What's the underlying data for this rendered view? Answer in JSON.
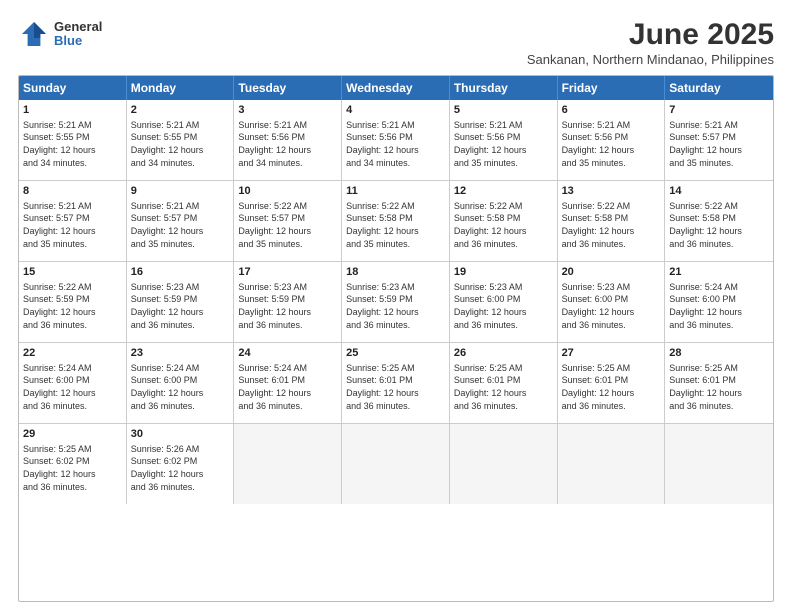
{
  "logo": {
    "general": "General",
    "blue": "Blue"
  },
  "header": {
    "month_year": "June 2025",
    "location": "Sankanan, Northern Mindanao, Philippines"
  },
  "weekdays": [
    "Sunday",
    "Monday",
    "Tuesday",
    "Wednesday",
    "Thursday",
    "Friday",
    "Saturday"
  ],
  "rows": [
    [
      {
        "day": "1",
        "info": "Sunrise: 5:21 AM\nSunset: 5:55 PM\nDaylight: 12 hours\nand 34 minutes."
      },
      {
        "day": "2",
        "info": "Sunrise: 5:21 AM\nSunset: 5:55 PM\nDaylight: 12 hours\nand 34 minutes."
      },
      {
        "day": "3",
        "info": "Sunrise: 5:21 AM\nSunset: 5:56 PM\nDaylight: 12 hours\nand 34 minutes."
      },
      {
        "day": "4",
        "info": "Sunrise: 5:21 AM\nSunset: 5:56 PM\nDaylight: 12 hours\nand 34 minutes."
      },
      {
        "day": "5",
        "info": "Sunrise: 5:21 AM\nSunset: 5:56 PM\nDaylight: 12 hours\nand 35 minutes."
      },
      {
        "day": "6",
        "info": "Sunrise: 5:21 AM\nSunset: 5:56 PM\nDaylight: 12 hours\nand 35 minutes."
      },
      {
        "day": "7",
        "info": "Sunrise: 5:21 AM\nSunset: 5:57 PM\nDaylight: 12 hours\nand 35 minutes."
      }
    ],
    [
      {
        "day": "8",
        "info": "Sunrise: 5:21 AM\nSunset: 5:57 PM\nDaylight: 12 hours\nand 35 minutes."
      },
      {
        "day": "9",
        "info": "Sunrise: 5:21 AM\nSunset: 5:57 PM\nDaylight: 12 hours\nand 35 minutes."
      },
      {
        "day": "10",
        "info": "Sunrise: 5:22 AM\nSunset: 5:57 PM\nDaylight: 12 hours\nand 35 minutes."
      },
      {
        "day": "11",
        "info": "Sunrise: 5:22 AM\nSunset: 5:58 PM\nDaylight: 12 hours\nand 35 minutes."
      },
      {
        "day": "12",
        "info": "Sunrise: 5:22 AM\nSunset: 5:58 PM\nDaylight: 12 hours\nand 36 minutes."
      },
      {
        "day": "13",
        "info": "Sunrise: 5:22 AM\nSunset: 5:58 PM\nDaylight: 12 hours\nand 36 minutes."
      },
      {
        "day": "14",
        "info": "Sunrise: 5:22 AM\nSunset: 5:58 PM\nDaylight: 12 hours\nand 36 minutes."
      }
    ],
    [
      {
        "day": "15",
        "info": "Sunrise: 5:22 AM\nSunset: 5:59 PM\nDaylight: 12 hours\nand 36 minutes."
      },
      {
        "day": "16",
        "info": "Sunrise: 5:23 AM\nSunset: 5:59 PM\nDaylight: 12 hours\nand 36 minutes."
      },
      {
        "day": "17",
        "info": "Sunrise: 5:23 AM\nSunset: 5:59 PM\nDaylight: 12 hours\nand 36 minutes."
      },
      {
        "day": "18",
        "info": "Sunrise: 5:23 AM\nSunset: 5:59 PM\nDaylight: 12 hours\nand 36 minutes."
      },
      {
        "day": "19",
        "info": "Sunrise: 5:23 AM\nSunset: 6:00 PM\nDaylight: 12 hours\nand 36 minutes."
      },
      {
        "day": "20",
        "info": "Sunrise: 5:23 AM\nSunset: 6:00 PM\nDaylight: 12 hours\nand 36 minutes."
      },
      {
        "day": "21",
        "info": "Sunrise: 5:24 AM\nSunset: 6:00 PM\nDaylight: 12 hours\nand 36 minutes."
      }
    ],
    [
      {
        "day": "22",
        "info": "Sunrise: 5:24 AM\nSunset: 6:00 PM\nDaylight: 12 hours\nand 36 minutes."
      },
      {
        "day": "23",
        "info": "Sunrise: 5:24 AM\nSunset: 6:00 PM\nDaylight: 12 hours\nand 36 minutes."
      },
      {
        "day": "24",
        "info": "Sunrise: 5:24 AM\nSunset: 6:01 PM\nDaylight: 12 hours\nand 36 minutes."
      },
      {
        "day": "25",
        "info": "Sunrise: 5:25 AM\nSunset: 6:01 PM\nDaylight: 12 hours\nand 36 minutes."
      },
      {
        "day": "26",
        "info": "Sunrise: 5:25 AM\nSunset: 6:01 PM\nDaylight: 12 hours\nand 36 minutes."
      },
      {
        "day": "27",
        "info": "Sunrise: 5:25 AM\nSunset: 6:01 PM\nDaylight: 12 hours\nand 36 minutes."
      },
      {
        "day": "28",
        "info": "Sunrise: 5:25 AM\nSunset: 6:01 PM\nDaylight: 12 hours\nand 36 minutes."
      }
    ],
    [
      {
        "day": "29",
        "info": "Sunrise: 5:25 AM\nSunset: 6:02 PM\nDaylight: 12 hours\nand 36 minutes."
      },
      {
        "day": "30",
        "info": "Sunrise: 5:26 AM\nSunset: 6:02 PM\nDaylight: 12 hours\nand 36 minutes."
      },
      {
        "day": "",
        "info": ""
      },
      {
        "day": "",
        "info": ""
      },
      {
        "day": "",
        "info": ""
      },
      {
        "day": "",
        "info": ""
      },
      {
        "day": "",
        "info": ""
      }
    ]
  ]
}
